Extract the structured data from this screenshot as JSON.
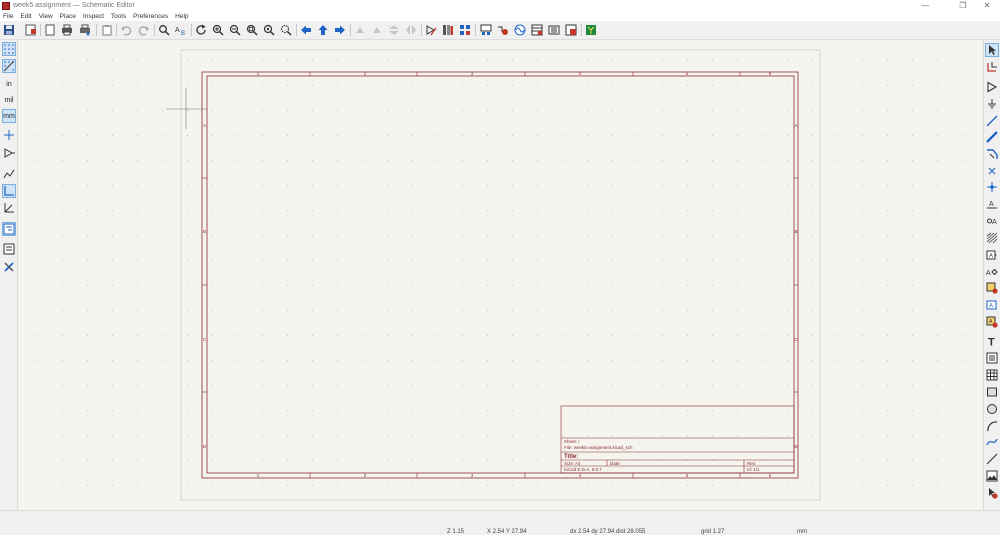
{
  "window": {
    "title": "week5 assignment — Schematic Editor",
    "controls": [
      "—",
      "❐",
      "✕"
    ]
  },
  "menu": [
    "File",
    "Edit",
    "View",
    "Place",
    "Inspect",
    "Tools",
    "Preferences",
    "Help"
  ],
  "toolbar_icons": [
    "save-icon",
    "schematic-setup-icon",
    "page-settings-icon",
    "print-icon",
    "plot-icon",
    "paste-icon",
    "undo-icon",
    "redo-icon",
    "find-icon",
    "find-replace-icon",
    "refresh-icon",
    "zoom-in-icon",
    "zoom-out-icon",
    "zoom-fit-icon",
    "zoom-objects-icon",
    "zoom-selection-icon",
    "navigate-back-icon",
    "navigate-up-icon",
    "navigate-forward-icon",
    "rotate-ccw-icon",
    "rotate-cw-icon",
    "mirror-vertical-icon",
    "mirror-horizontal-icon",
    "symbol-editor-icon",
    "symbol-browser-icon",
    "footprint-assign-icon",
    "annotate-icon",
    "erc-icon",
    "simulator-icon",
    "bom-icon",
    "netlist-icon",
    "pcb-editor-icon"
  ],
  "left_toolbar_icons": [
    "grid-dots-icon",
    "grid-override-icon",
    "inches-icon",
    "mils-icon",
    "millimeters-icon",
    "cursor-shape-icon",
    "hidden-pins-icon",
    "line-mode-free-icon",
    "line-mode-90-icon",
    "line-mode-45-icon",
    "hierarchy-nav-icon",
    "properties-panel-icon",
    "tools-icon"
  ],
  "left_toolbar_labels": {
    "in": "in",
    "mil": "mil",
    "mm": "mm"
  },
  "right_toolbar_icons": [
    "select-icon",
    "highlight-net-icon",
    "add-symbol-icon",
    "add-power-icon",
    "add-wire-icon",
    "add-bus-icon",
    "bus-entry-icon",
    "no-connect-icon",
    "junction-icon",
    "net-label-icon",
    "global-label-icon",
    "hier-label-icon",
    "hier-sheet-icon",
    "import-sheet-pin-icon",
    "add-text-icon",
    "add-textbox-icon",
    "add-table-icon",
    "add-rectangle-icon",
    "add-circle-icon",
    "add-arc-icon",
    "add-bezier-icon",
    "add-line-icon",
    "add-image-icon",
    "delete-icon"
  ],
  "sheet": {
    "col_labels": [
      "1",
      "2",
      "3",
      "4",
      "5",
      "6"
    ],
    "row_labels": [
      "A",
      "B",
      "C",
      "D"
    ],
    "title_block": {
      "sheet_line": "Sheet: /",
      "file_line": "File: week5-assignment.kicad_sch",
      "title_line": "Title:",
      "size_line": "Size: A4",
      "date_line": "Date:",
      "rev_line": "Rev:",
      "kicad_line": "KiCad E.D.A. 9.0.7",
      "id_line": "Id: 1/1"
    }
  },
  "status": {
    "zoom": "Z 1.15",
    "coords": "X 2.54  Y 27.94",
    "delta": "dx 2.54  dy 27.94  dist 28.055",
    "grid": "grid 1.27",
    "units": "mm"
  },
  "colors": {
    "sheet_border": "#8b2b2b",
    "canvas_bg": "#f5f4ef",
    "accent": "#1f63c6"
  }
}
